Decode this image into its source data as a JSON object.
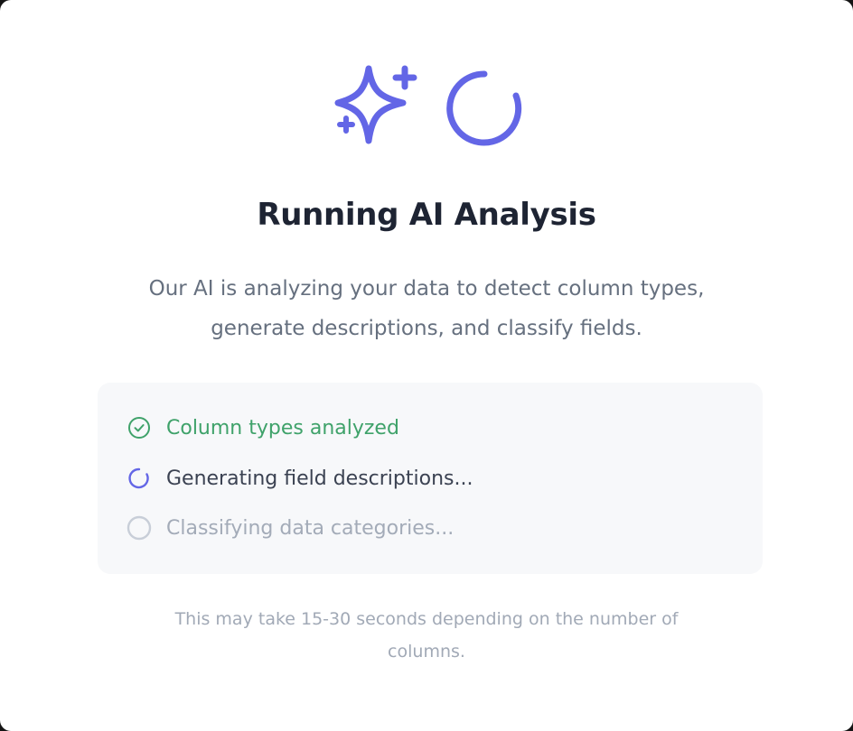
{
  "modal": {
    "title": "Running AI Analysis",
    "description": "Our AI is analyzing your data to detect column types, generate descriptions, and classify fields.",
    "icons": {
      "primary": "sparkles-icon",
      "secondary": "spinner-icon",
      "accent_color": "#6366e6"
    },
    "steps": [
      {
        "label": "Column types analyzed",
        "status": "completed",
        "icon": "check-circle-icon",
        "color": "#3fa26a"
      },
      {
        "label": "Generating field descriptions...",
        "status": "in-progress",
        "icon": "spinner-icon",
        "color": "#6366e6"
      },
      {
        "label": "Classifying data categories...",
        "status": "pending",
        "icon": "empty-circle-icon",
        "color": "#c8ced8"
      }
    ],
    "footnote": "This may take 15-30 seconds depending on the number of columns."
  }
}
